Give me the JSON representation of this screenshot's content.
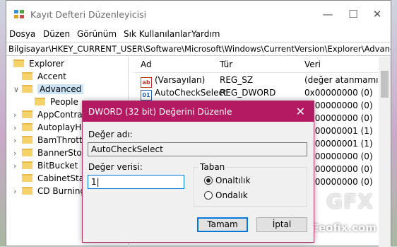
{
  "window": {
    "title": "Kayıt Defteri Düzenleyicisi",
    "min_glyph": "—",
    "max_glyph": "☐",
    "close_glyph": "✕"
  },
  "menu": [
    "Dosya",
    "Düzen",
    "Görünüm",
    "Sık Kullanılanlar",
    "Yardım"
  ],
  "address": "Bilgisayar\\HKEY_CURRENT_USER\\Software\\Microsoft\\Windows\\CurrentVersion\\Explorer\\Advanced",
  "tree": [
    {
      "label": "Explorer",
      "chevron": ""
    },
    {
      "label": "Accent",
      "chevron": ""
    },
    {
      "label": "Advanced",
      "chevron": "∨"
    },
    {
      "label": "People",
      "chevron": ""
    },
    {
      "label": "AppContract",
      "chevron": "›"
    },
    {
      "label": "AutoplayHandl",
      "chevron": "›"
    },
    {
      "label": "BamThrottling",
      "chevron": "›"
    },
    {
      "label": "BannerStore",
      "chevron": "›"
    },
    {
      "label": "BitBucket",
      "chevron": "›"
    },
    {
      "label": "CabinetState",
      "chevron": ""
    },
    {
      "label": "CD Burning",
      "chevron": "›"
    }
  ],
  "list": {
    "headers": {
      "name": "Ad",
      "type": "Tür",
      "value": "Veri"
    },
    "rows": [
      {
        "icon": "ab",
        "name": "(Varsayılan)",
        "type": "REG_SZ",
        "value": "(değer atanmamış)"
      },
      {
        "icon": "bin",
        "name": "AutoCheckSelect",
        "type": "REG_DWORD",
        "value": "0x00000000 (0)"
      },
      {
        "icon": "",
        "name": "",
        "type": "",
        "value": "0x00000000 (0)"
      },
      {
        "icon": "",
        "name": "",
        "type": "",
        "value": "0x00000000 (0)"
      },
      {
        "icon": "",
        "name": "",
        "type": "",
        "value": "0x00000001 (1)"
      },
      {
        "icon": "",
        "name": "",
        "type": "",
        "value": "0x00000001 (1)"
      },
      {
        "icon": "",
        "name": "",
        "type": "",
        "value": "0x00000000 (0)"
      },
      {
        "icon": "",
        "name": "",
        "type": "",
        "value": "0x00000000 (0)"
      },
      {
        "icon": "",
        "name": "",
        "type": "",
        "value": "0x00000000 (0)"
      }
    ]
  },
  "dialog": {
    "title": "DWORD (32 bit) Değerini Düzenle",
    "close_glyph": "✕",
    "name_label": "Değer adı:",
    "name_value": "AutoCheckSelect",
    "data_label": "Değer verisi:",
    "data_value": "1",
    "base_label": "Taban",
    "radio_hex": "Onaltılık",
    "radio_dec": "Ondalık",
    "selected_base": "hex",
    "ok": "Tamam",
    "cancel": "İptal"
  },
  "watermark": {
    "logo": "GFX",
    "site": "Ceofix.com"
  },
  "colors": {
    "dialog_title_bg": "#b41a62",
    "selection": "#cce4f7",
    "focus_border": "#0078d7"
  }
}
